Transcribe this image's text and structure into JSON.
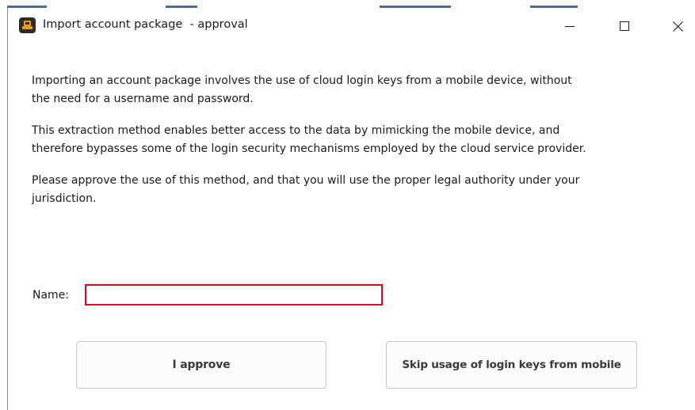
{
  "window": {
    "title": "Import account package  - approval",
    "controls": {
      "minimize_icon": "minimize-icon",
      "maximize_icon": "maximize-icon",
      "close_icon": "close-icon"
    },
    "app_icon": "app-icon"
  },
  "body": {
    "paragraphs": [
      "Importing an account package involves the use of cloud login keys from a mobile device, without the need for a username and password.",
      "This extraction method enables better access to the data by mimicking the mobile device, and therefore bypasses some of the login security mechanisms employed by the cloud service provider.",
      "Please approve the use of this method, and that you will use the proper legal authority under your jurisdiction."
    ]
  },
  "form": {
    "name_label": "Name:",
    "name_value": "",
    "name_placeholder": ""
  },
  "buttons": {
    "approve_label": "I approve",
    "skip_label": "Skip usage of login keys from mobile"
  },
  "colors": {
    "input_error_border": "#e0061a",
    "button_border": "#c7c7c7",
    "app_icon_bg": "#2b2b2b",
    "app_icon_accent": "#f29a1f"
  }
}
